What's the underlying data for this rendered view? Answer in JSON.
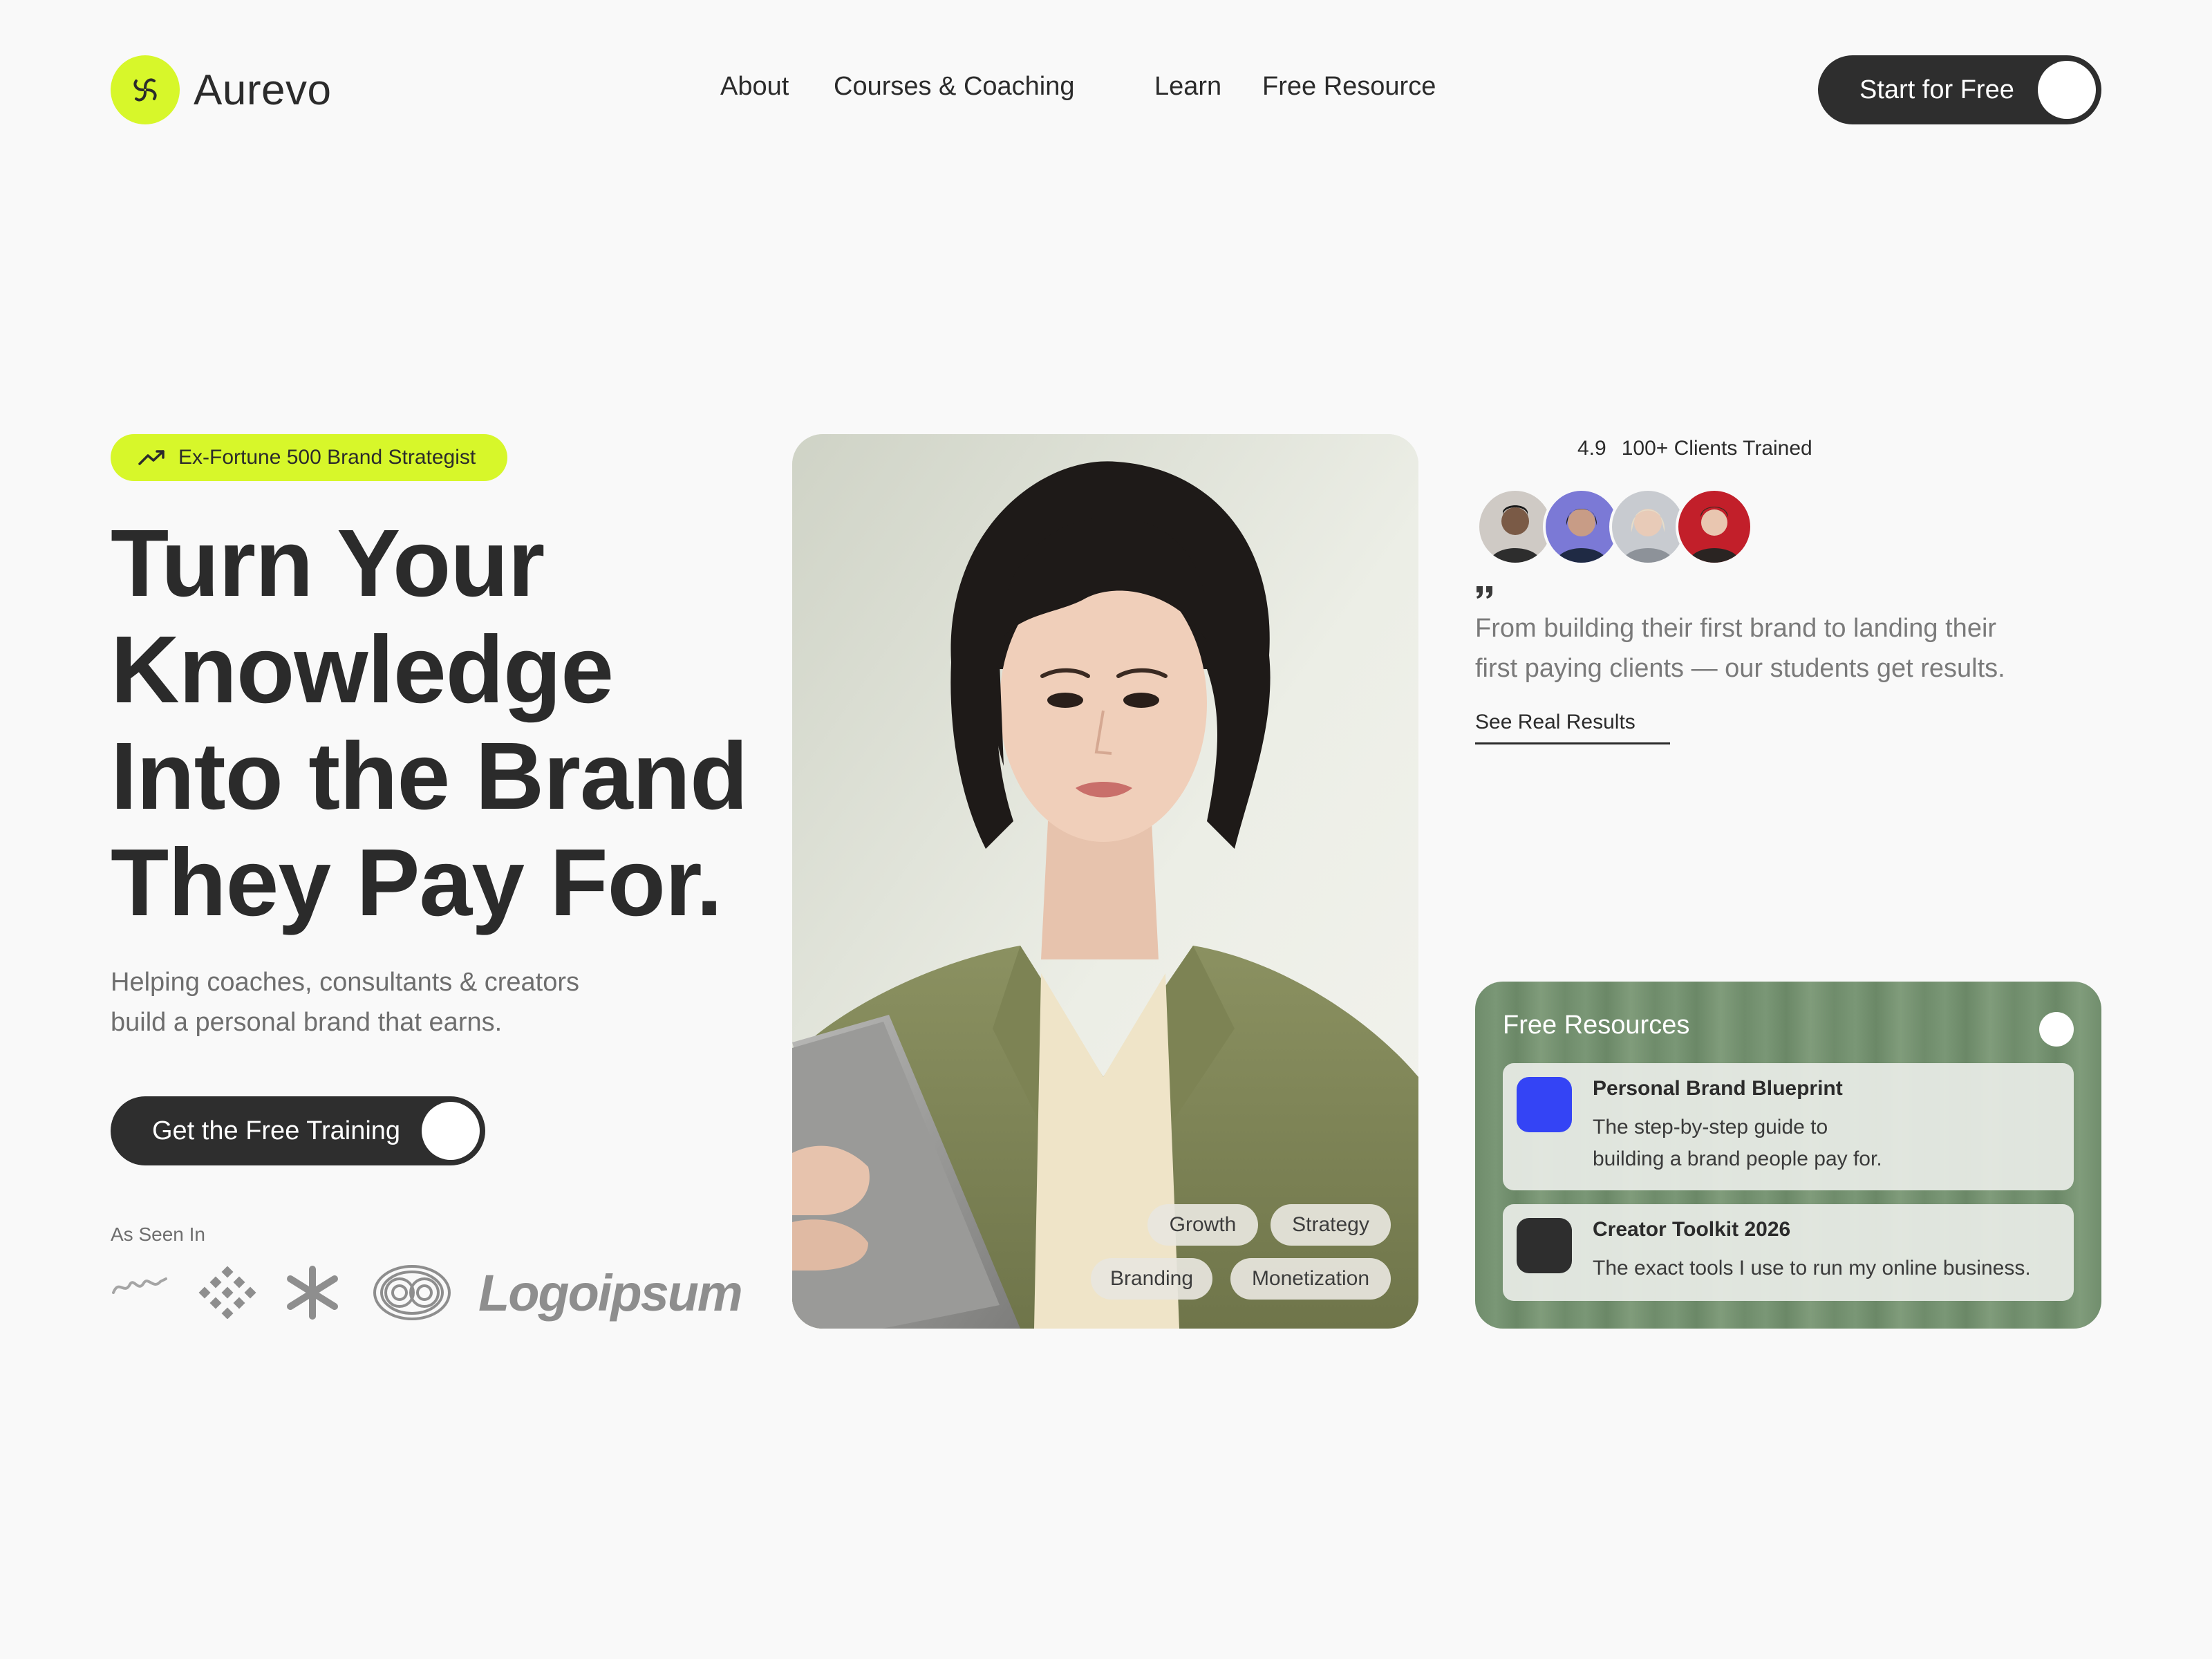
{
  "brand": {
    "name": "Aurevo",
    "accent": "#d7f72a",
    "dark": "#2e2e2e"
  },
  "nav": {
    "items": [
      {
        "label": "About"
      },
      {
        "label": "Courses & Coaching"
      },
      {
        "label": "Learn"
      },
      {
        "label": "Free Resource"
      }
    ],
    "cta_label": "Start for Free"
  },
  "hero": {
    "badge": "Ex-Fortune 500 Brand Strategist",
    "headline": [
      "Turn Your",
      "Knowledge",
      "Into the Brand",
      "They Pay For."
    ],
    "subtext": [
      "Helping coaches, consultants & creators",
      "build a personal brand that earns."
    ],
    "cta_label": "Get the Free Training",
    "seen_in_label": "As Seen In",
    "seen_in_logo_text": "Logoipsum"
  },
  "photo": {
    "tags": [
      "Growth",
      "Strategy",
      "Branding",
      "Monetization"
    ]
  },
  "social_proof": {
    "rating": "4.9",
    "clients": "100+ Clients Trained",
    "quote": [
      "From building their first brand to landing their",
      "first paying clients — our students get results."
    ],
    "link_label": "See Real Results"
  },
  "resources": {
    "title": "Free Resources",
    "items": [
      {
        "title": "Personal Brand Blueprint",
        "desc": [
          "The step-by-step guide to",
          "building a brand people pay for."
        ],
        "color": "#3444f5"
      },
      {
        "title": "Creator Toolkit 2026",
        "desc": [
          "The exact tools I use to run my online business."
        ],
        "color": "#2e2e2e"
      }
    ]
  }
}
